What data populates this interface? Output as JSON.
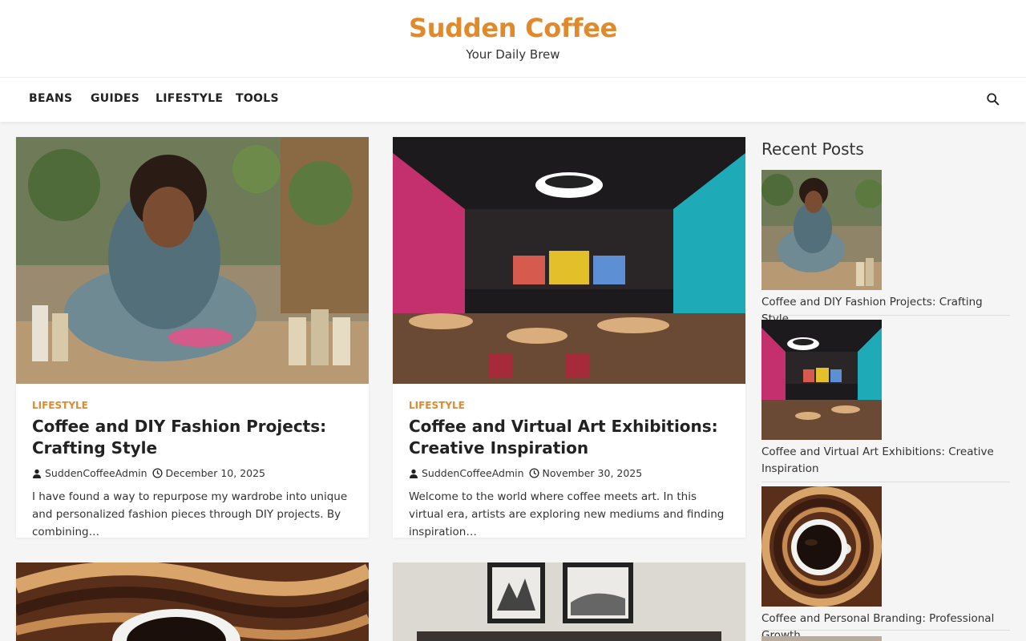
{
  "site": {
    "title": "Sudden Coffee",
    "tagline": "Your Daily Brew",
    "accent_color": "#e08a2c"
  },
  "nav": {
    "items": [
      {
        "label": "BEANS"
      },
      {
        "label": "GUIDES"
      },
      {
        "label": "LIFESTYLE"
      },
      {
        "label": "TOOLS"
      }
    ],
    "search_icon": "search-icon"
  },
  "posts": [
    {
      "category": "LIFESTYLE",
      "title": "Coffee and DIY Fashion Projects: Crafting Style",
      "author": "SuddenCoffeeAdmin",
      "date": "December 10, 2025",
      "excerpt": "I have found a way to repurpose my wardrobe into unique and personalized fashion pieces through DIY projects. By combining…"
    },
    {
      "category": "LIFESTYLE",
      "title": "Coffee and Virtual Art Exhibitions: Creative Inspiration",
      "author": "SuddenCoffeeAdmin",
      "date": "November 30, 2025",
      "excerpt": "Welcome to the world where coffee meets art. In this virtual era, artists are exploring new mediums and finding inspiration…"
    }
  ],
  "sidebar": {
    "heading": "Recent Posts",
    "items": [
      {
        "title": "Coffee and DIY Fashion Projects: Crafting Style"
      },
      {
        "title": "Coffee and Virtual Art Exhibitions: Creative Inspiration"
      },
      {
        "title": "Coffee and Personal Branding: Professional Growth"
      }
    ]
  }
}
